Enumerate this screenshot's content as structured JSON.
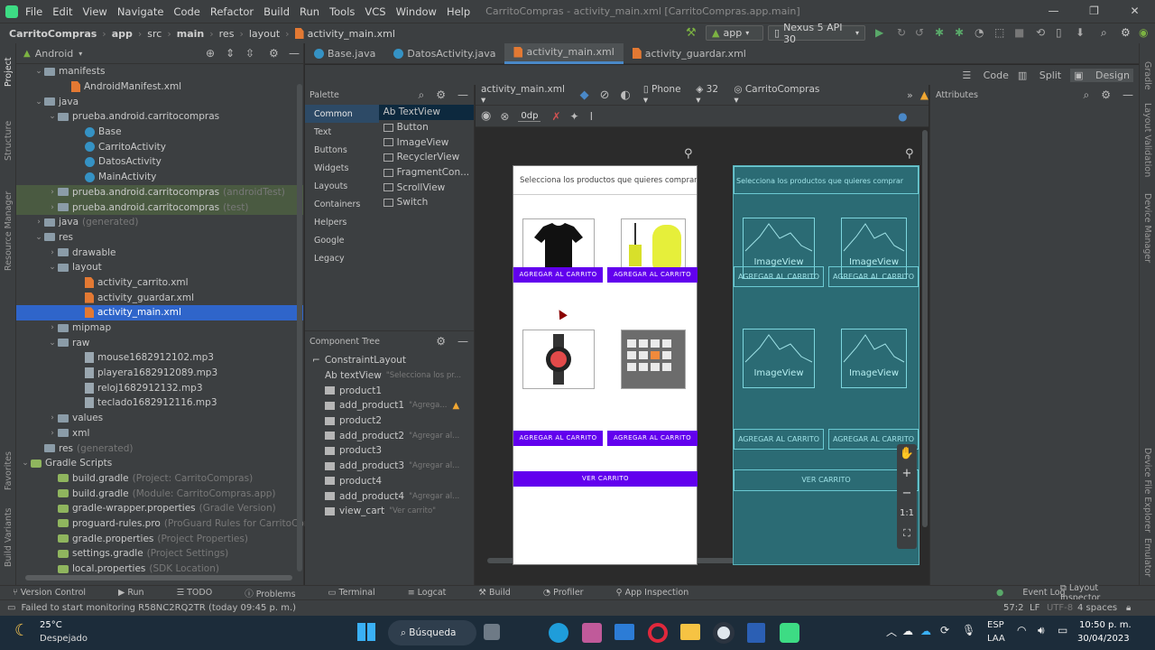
{
  "menu": {
    "items": [
      "File",
      "Edit",
      "View",
      "Navigate",
      "Code",
      "Refactor",
      "Build",
      "Run",
      "Tools",
      "VCS",
      "Window",
      "Help"
    ],
    "window_title": "CarritoCompras - activity_main.xml [CarritoCompras.app.main]"
  },
  "navbar": {
    "breadcrumb": [
      "CarritoCompras",
      "app",
      "src",
      "main",
      "res",
      "layout",
      "activity_main.xml"
    ],
    "run_config": "app",
    "device": "Nexus 5 API 30"
  },
  "side_tools": {
    "left": [
      "Project",
      "Structure",
      "Resource Manager",
      "Favorites",
      "Build Variants"
    ],
    "right": [
      "Gradle",
      "Layout Validation",
      "Device Manager",
      "Device File Explorer",
      "Emulator"
    ]
  },
  "project": {
    "view_mode": "Android",
    "tree": [
      {
        "label": "manifests",
        "indent": 1,
        "kind": "folder",
        "arrow": "v"
      },
      {
        "label": "AndroidManifest.xml",
        "indent": 3,
        "kind": "xml"
      },
      {
        "label": "java",
        "indent": 1,
        "kind": "folder",
        "arrow": "v"
      },
      {
        "label": "prueba.android.carritocompras",
        "indent": 2,
        "kind": "folder",
        "arrow": "v"
      },
      {
        "label": "Base",
        "indent": 4,
        "kind": "class"
      },
      {
        "label": "CarritoActivity",
        "indent": 4,
        "kind": "class"
      },
      {
        "label": "DatosActivity",
        "indent": 4,
        "kind": "class"
      },
      {
        "label": "MainActivity",
        "indent": 4,
        "kind": "class"
      },
      {
        "label": "prueba.android.carritocompras",
        "hint": "(androidTest)",
        "indent": 2,
        "kind": "folder",
        "arrow": ">",
        "hl": true
      },
      {
        "label": "prueba.android.carritocompras",
        "hint": "(test)",
        "indent": 2,
        "kind": "folder",
        "arrow": ">",
        "hl": true
      },
      {
        "label": "java",
        "hint": "(generated)",
        "indent": 1,
        "kind": "folder",
        "arrow": ">"
      },
      {
        "label": "res",
        "indent": 1,
        "kind": "folder",
        "arrow": "v"
      },
      {
        "label": "drawable",
        "indent": 2,
        "kind": "folder",
        "arrow": ">"
      },
      {
        "label": "layout",
        "indent": 2,
        "kind": "folder",
        "arrow": "v"
      },
      {
        "label": "activity_carrito.xml",
        "indent": 4,
        "kind": "xml"
      },
      {
        "label": "activity_guardar.xml",
        "indent": 4,
        "kind": "xml"
      },
      {
        "label": "activity_main.xml",
        "indent": 4,
        "kind": "xml",
        "sel": true
      },
      {
        "label": "mipmap",
        "indent": 2,
        "kind": "folder",
        "arrow": ">"
      },
      {
        "label": "raw",
        "indent": 2,
        "kind": "folder",
        "arrow": "v"
      },
      {
        "label": "mouse1682912102.mp3",
        "indent": 4,
        "kind": "mp3"
      },
      {
        "label": "playera1682912089.mp3",
        "indent": 4,
        "kind": "mp3"
      },
      {
        "label": "reloj1682912132.mp3",
        "indent": 4,
        "kind": "mp3"
      },
      {
        "label": "teclado1682912116.mp3",
        "indent": 4,
        "kind": "mp3"
      },
      {
        "label": "values",
        "indent": 2,
        "kind": "folder",
        "arrow": ">"
      },
      {
        "label": "xml",
        "indent": 2,
        "kind": "folder",
        "arrow": ">"
      },
      {
        "label": "res",
        "hint": "(generated)",
        "indent": 1,
        "kind": "folder"
      },
      {
        "label": "Gradle Scripts",
        "indent": 0,
        "kind": "grad",
        "arrow": "v"
      },
      {
        "label": "build.gradle",
        "hint": "(Project: CarritoCompras)",
        "indent": 2,
        "kind": "grad"
      },
      {
        "label": "build.gradle",
        "hint": "(Module: CarritoCompras.app)",
        "indent": 2,
        "kind": "grad"
      },
      {
        "label": "gradle-wrapper.properties",
        "hint": "(Gradle Version)",
        "indent": 2,
        "kind": "grad"
      },
      {
        "label": "proguard-rules.pro",
        "hint": "(ProGuard Rules for CarritoCompras.app)",
        "indent": 2,
        "kind": "grad"
      },
      {
        "label": "gradle.properties",
        "hint": "(Project Properties)",
        "indent": 2,
        "kind": "grad"
      },
      {
        "label": "settings.gradle",
        "hint": "(Project Settings)",
        "indent": 2,
        "kind": "grad"
      },
      {
        "label": "local.properties",
        "hint": "(SDK Location)",
        "indent": 2,
        "kind": "grad"
      }
    ]
  },
  "tabs": [
    {
      "label": "Base.java",
      "active": false
    },
    {
      "label": "DatosActivity.java",
      "active": false
    },
    {
      "label": "activity_main.xml",
      "active": true
    },
    {
      "label": "activity_guardar.xml",
      "active": false
    }
  ],
  "modes": [
    "Code",
    "Split",
    "Design"
  ],
  "palette": {
    "title": "Palette",
    "categories": [
      "Common",
      "Text",
      "Buttons",
      "Widgets",
      "Layouts",
      "Containers",
      "Helpers",
      "Google",
      "Legacy"
    ],
    "widgets": [
      "Ab TextView",
      "Button",
      "ImageView",
      "RecyclerView",
      "FragmentCon...",
      "ScrollView",
      "Switch"
    ]
  },
  "component_tree": {
    "title": "Component Tree",
    "items": [
      {
        "label": "ConstraintLayout",
        "indent": 0
      },
      {
        "label": "Ab textView",
        "hint": "\"Selecciona los pr...",
        "indent": 1
      },
      {
        "label": "product1",
        "indent": 1
      },
      {
        "label": "add_product1",
        "hint": "\"Agrega...",
        "indent": 1,
        "warn": true
      },
      {
        "label": "product2",
        "indent": 1
      },
      {
        "label": "add_product2",
        "hint": "\"Agregar al...",
        "indent": 1
      },
      {
        "label": "product3",
        "indent": 1
      },
      {
        "label": "add_product3",
        "hint": "\"Agregar al...",
        "indent": 1
      },
      {
        "label": "product4",
        "indent": 1
      },
      {
        "label": "add_product4",
        "hint": "\"Agregar al...",
        "indent": 1
      },
      {
        "label": "view_cart",
        "hint": "\"Ver carrito\"",
        "indent": 1
      }
    ]
  },
  "design_toolbar": {
    "file": "activity_main.xml",
    "device": "Phone",
    "api": "32",
    "theme": "CarritoCompras",
    "margin": "0dp"
  },
  "attributes": {
    "title": "Attributes"
  },
  "phone_preview": {
    "heading": "Selecciona los productos que quieres comprar",
    "add_button": "AGREGAR AL CARRITO",
    "cart_button": "VER CARRITO"
  },
  "blueprint": {
    "heading": "Selecciona los productos que quieres comprar",
    "image_label": "ImageView",
    "add_button": "AGREGAR AL CARRITO",
    "cart_button": "VER CARRITO"
  },
  "zoom": [
    "✋",
    "+",
    "−",
    "1:1",
    "⛶"
  ],
  "bottom_tools": [
    "Version Control",
    "Run",
    "TODO",
    "Problems",
    "Terminal",
    "Logcat",
    "Build",
    "Profiler",
    "App Inspection"
  ],
  "bottom_right": [
    "Event Log",
    "Layout Inspector"
  ],
  "status": {
    "message": "Failed to start monitoring R58NC2RQ2TR (today 09:45 p. m.)",
    "position": "57:2",
    "line_sep": "LF",
    "encoding": "UTF-8",
    "indent": "4 spaces"
  },
  "taskbar": {
    "weather_temp": "25°C",
    "weather_desc": "Despejado",
    "search": "Búsqueda",
    "lang1": "ESP",
    "lang2": "LAA",
    "time": "10:50 p. m.",
    "date": "30/04/2023"
  }
}
